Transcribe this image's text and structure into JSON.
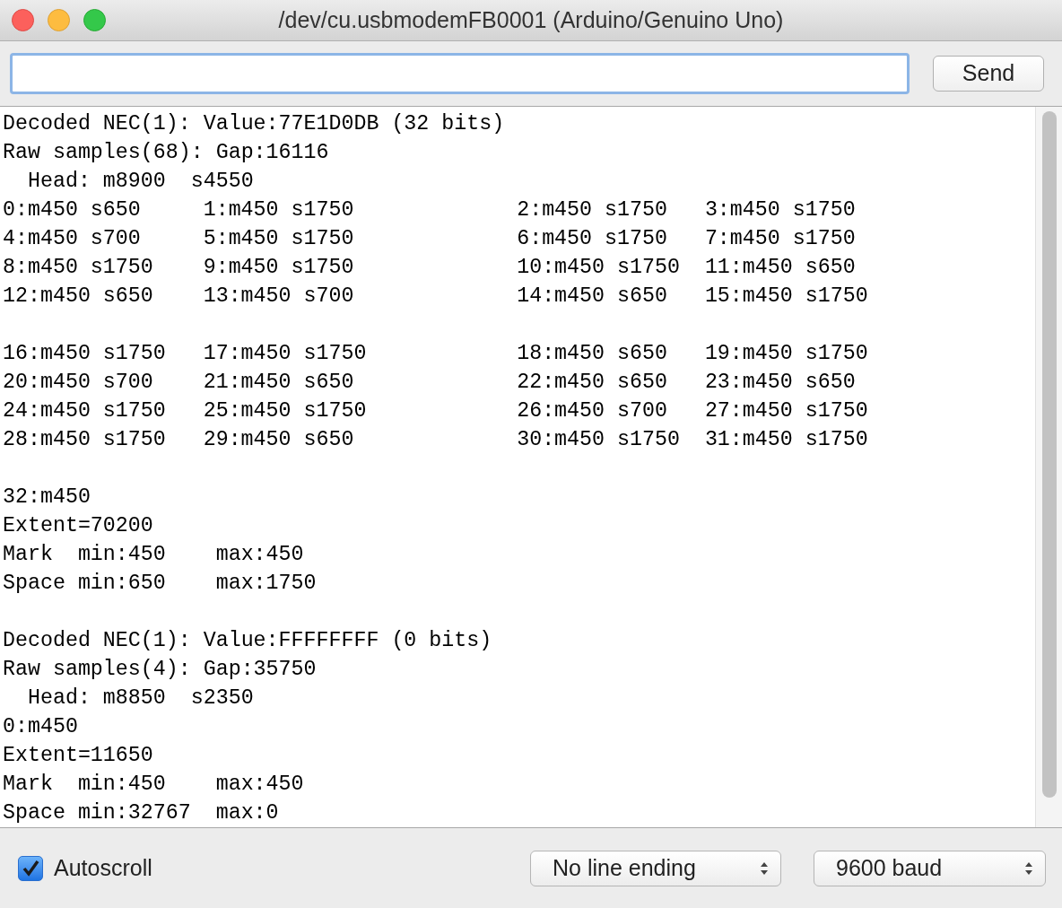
{
  "window": {
    "title": "/dev/cu.usbmodemFB0001 (Arduino/Genuino Uno)"
  },
  "send_button": "Send",
  "output": [
    {
      "kind": "text",
      "text": "Decoded NEC(1): Value:77E1D0DB (32 bits)"
    },
    {
      "kind": "text",
      "text": "Raw samples(68): Gap:16116"
    },
    {
      "kind": "text",
      "text": "  Head: m8900  s4550"
    },
    {
      "kind": "columns",
      "cells": [
        "0:m450 s650",
        "1:m450 s1750",
        "2:m450 s1750",
        "3:m450 s1750"
      ]
    },
    {
      "kind": "columns",
      "cells": [
        "4:m450 s700",
        "5:m450 s1750",
        "6:m450 s1750",
        "7:m450 s1750"
      ]
    },
    {
      "kind": "columns",
      "cells": [
        "8:m450 s1750",
        "9:m450 s1750",
        "10:m450 s1750",
        "11:m450 s650"
      ]
    },
    {
      "kind": "columns",
      "cells": [
        "12:m450 s650",
        "13:m450 s700",
        "14:m450 s650",
        "15:m450 s1750"
      ]
    },
    {
      "kind": "blank"
    },
    {
      "kind": "columns",
      "cells": [
        "16:m450 s1750",
        "17:m450 s1750",
        "18:m450 s650",
        "19:m450 s1750"
      ]
    },
    {
      "kind": "columns",
      "cells": [
        "20:m450 s700",
        "21:m450 s650",
        "22:m450 s650",
        "23:m450 s650"
      ]
    },
    {
      "kind": "columns",
      "cells": [
        "24:m450 s1750",
        "25:m450 s1750",
        "26:m450 s700",
        "27:m450 s1750"
      ]
    },
    {
      "kind": "columns",
      "cells": [
        "28:m450 s1750",
        "29:m450 s650",
        "30:m450 s1750",
        "31:m450 s1750"
      ]
    },
    {
      "kind": "blank"
    },
    {
      "kind": "text",
      "text": "32:m450"
    },
    {
      "kind": "text",
      "text": "Extent=70200"
    },
    {
      "kind": "text",
      "text": "Mark  min:450    max:450"
    },
    {
      "kind": "text",
      "text": "Space min:650    max:1750"
    },
    {
      "kind": "blank"
    },
    {
      "kind": "text",
      "text": "Decoded NEC(1): Value:FFFFFFFF (0 bits)"
    },
    {
      "kind": "text",
      "text": "Raw samples(4): Gap:35750"
    },
    {
      "kind": "text",
      "text": "  Head: m8850  s2350"
    },
    {
      "kind": "text",
      "text": "0:m450"
    },
    {
      "kind": "text",
      "text": "Extent=11650"
    },
    {
      "kind": "text",
      "text": "Mark  min:450    max:450"
    },
    {
      "kind": "text",
      "text": "Space min:32767  max:0"
    }
  ],
  "autoscroll": {
    "label": "Autoscroll",
    "checked": true
  },
  "line_ending": {
    "value": "No line ending"
  },
  "baud": {
    "value": "9600 baud"
  }
}
